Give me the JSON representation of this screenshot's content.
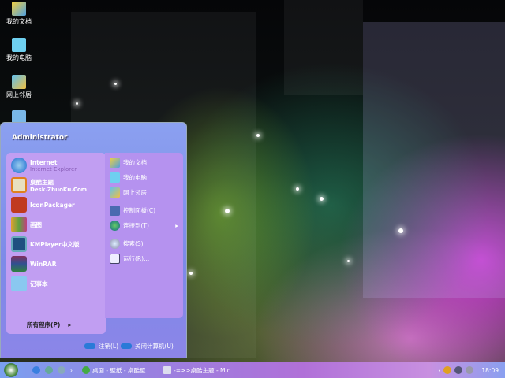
{
  "desktop_icons": [
    {
      "label": "我的文档"
    },
    {
      "label": "我的电脑"
    },
    {
      "label": "网上邻居"
    }
  ],
  "start_menu": {
    "user": "Administrator",
    "pinned": [
      {
        "title": "Internet",
        "subtitle": "Internet Explorer",
        "icon": "ie-icon"
      },
      {
        "title": "桌酷主题",
        "subtitle": "Desk.ZhuoKu.Com",
        "icon": "theme-icon"
      }
    ],
    "programs": [
      {
        "title": "IconPackager",
        "icon": "iconpackager-icon"
      },
      {
        "title": "画图",
        "icon": "paint-icon"
      },
      {
        "title": "KMPlayer中文版",
        "icon": "kmplayer-icon"
      },
      {
        "title": "WinRAR",
        "icon": "winrar-icon"
      },
      {
        "title": "记事本",
        "icon": "notepad-icon"
      }
    ],
    "all_programs": "所有程序(P)",
    "right_items": [
      {
        "label": "我的文档"
      },
      {
        "label": "我的电脑"
      },
      {
        "label": "网上邻居"
      },
      {
        "label": "控制面板(C)"
      },
      {
        "label": "连接到(T)"
      },
      {
        "label": "搜索(S)"
      },
      {
        "label": "运行(R)..."
      }
    ],
    "logoff": "注销(L)",
    "shutdown": "关闭计算机(U)"
  },
  "taskbar": {
    "tasks": [
      {
        "label": "桌面 - 壁纸 - 桌酷壁..."
      },
      {
        "label": "-=>>桌酷主题 - Mic..."
      }
    ],
    "clock": "18:09"
  }
}
